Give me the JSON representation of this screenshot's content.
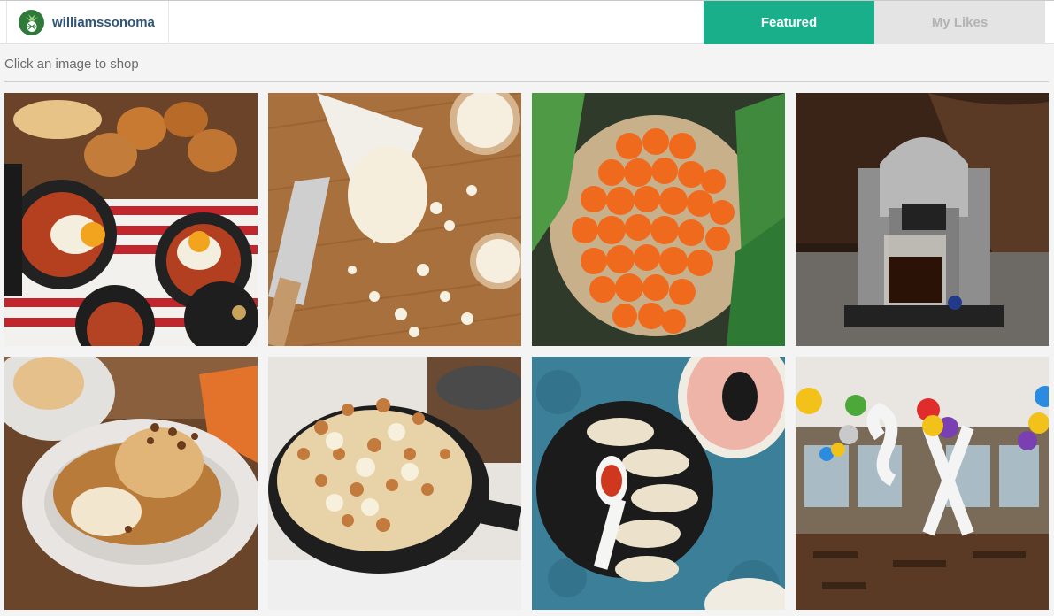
{
  "header": {
    "brand_name": "williamssonoma",
    "brand_logo_icon": "pineapple-icon",
    "tabs": [
      {
        "label": "Featured",
        "active": true
      },
      {
        "label": "My Likes",
        "active": false
      }
    ]
  },
  "main": {
    "hint": "Click an image to shop",
    "tiles": [
      {
        "subject": "baked eggs in cast-iron cocottes with toasted bread"
      },
      {
        "subject": "popcorn with cheese grater on wooden table"
      },
      {
        "subject": "basket of tangerines with bok choy"
      },
      {
        "subject": "Nespresso coffee machine"
      },
      {
        "subject": "sticky bun with pecans and caramel sauce"
      },
      {
        "subject": "cauliflower gratin in cast-iron skillet"
      },
      {
        "subject": "dumplings on black plate with dipping sauce spoon"
      },
      {
        "subject": "restaurant interior with balloons"
      }
    ]
  },
  "colors": {
    "accent": "#1aaf8b",
    "brand_text": "#2f5577",
    "inactive_tab": "#e4e4e4"
  }
}
